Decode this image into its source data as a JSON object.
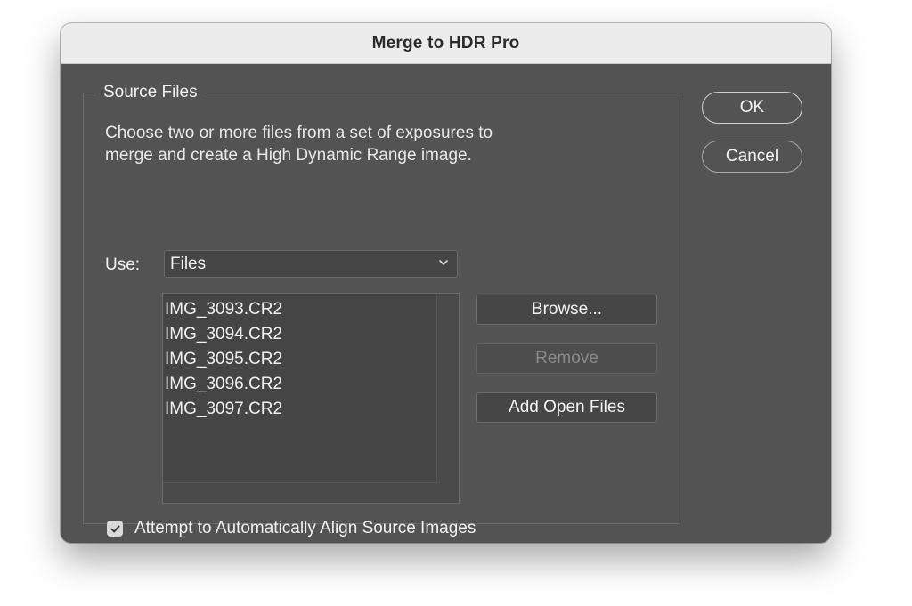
{
  "window": {
    "title": "Merge to HDR Pro"
  },
  "source_files": {
    "legend": "Source Files",
    "description_line1": "Choose two or more files from a set of exposures to",
    "description_line2": "merge and create a High Dynamic Range image.",
    "use_label": "Use:",
    "use_value": "Files",
    "files": [
      "IMG_3093.CR2",
      "IMG_3094.CR2",
      "IMG_3095.CR2",
      "IMG_3096.CR2",
      "IMG_3097.CR2"
    ],
    "browse_label": "Browse...",
    "remove_label": "Remove",
    "add_open_label": "Add Open Files",
    "align_label": "Attempt to Automatically Align Source Images",
    "align_checked": true
  },
  "buttons": {
    "ok_label": "OK",
    "cancel_label": "Cancel"
  },
  "icons": {
    "dropdown": "chevron-down-icon",
    "checkbox": "checkmark-icon"
  }
}
